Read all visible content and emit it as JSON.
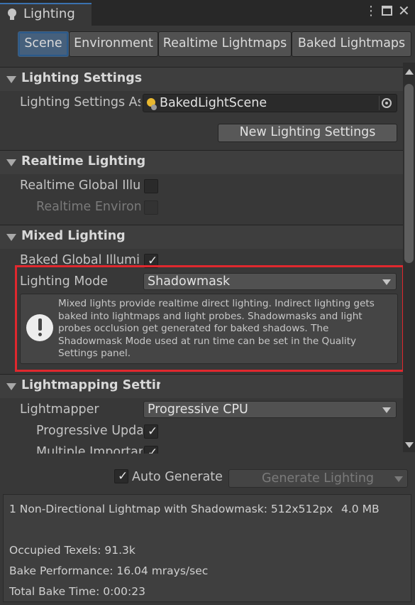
{
  "window": {
    "title": "Lighting"
  },
  "tabs": [
    {
      "label": "Scene",
      "active": true
    },
    {
      "label": "Environment",
      "active": false
    },
    {
      "label": "Realtime Lightmaps",
      "active": false
    },
    {
      "label": "Baked Lightmaps",
      "active": false
    }
  ],
  "lighting_settings": {
    "header": "Lighting Settings",
    "asset_label": "Lighting Settings As",
    "asset_value": "BakedLightScene",
    "new_button": "New Lighting Settings"
  },
  "realtime_lighting": {
    "header": "Realtime Lighting",
    "gi_label": "Realtime Global Illu",
    "gi_checked": false,
    "env_label": "Realtime Environ",
    "env_checked": false
  },
  "mixed_lighting": {
    "header": "Mixed Lighting",
    "baked_gi_label": "Baked Global Illumi",
    "baked_gi_checked": true,
    "mode_label": "Lighting Mode",
    "mode_value": "Shadowmask",
    "help_line1": "Mixed lights provide realtime direct lighting. Indirect lighting gets",
    "help_line2": "baked into lightmaps and light probes. Shadowmasks and light",
    "help_line3": "probes occlusion get generated for baked shadows. The",
    "help_line4": "Shadowmask Mode used at run time can be set in the Quality",
    "help_line5": "Settings panel."
  },
  "lightmapping": {
    "header": "Lightmapping Setting",
    "lightmapper_label": "Lightmapper",
    "lightmapper_value": "Progressive CPU",
    "progressive_label": "Progressive Upda",
    "progressive_checked": true,
    "multiple_label": "Multiple Importar",
    "multiple_checked": true
  },
  "footer": {
    "auto_generate_label": "Auto Generate",
    "auto_generate_checked": true,
    "generate_button": "Generate Lighting"
  },
  "info": {
    "lightmap_line": "1 Non-Directional Lightmap with Shadowmask: 512x512px",
    "lightmap_size": "4.0 MB",
    "occupied": "Occupied Texels: 91.3k",
    "performance": "Bake Performance: 16.04 mrays/sec",
    "bake_time": "Total Bake Time: 0:00:23"
  },
  "colors": {
    "highlight_box": "#e0282e",
    "active_tab": "#46607c",
    "background": "#383838"
  }
}
